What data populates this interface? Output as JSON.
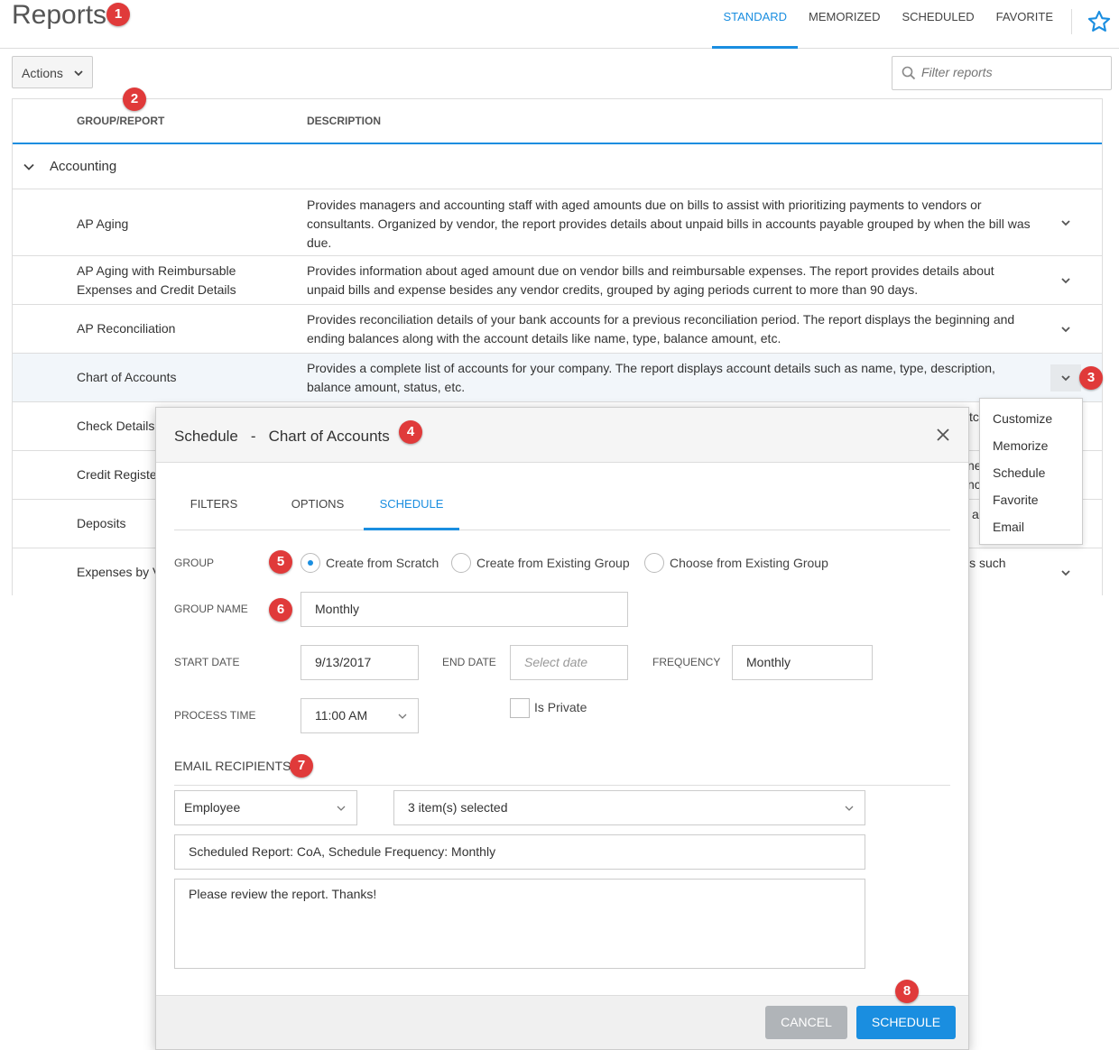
{
  "header": {
    "title": "Reports",
    "tabs": [
      {
        "label": "STANDARD",
        "active": true
      },
      {
        "label": "MEMORIZED"
      },
      {
        "label": "SCHEDULED"
      },
      {
        "label": "FAVORITE"
      }
    ],
    "star_icon": "star-outline-icon"
  },
  "toolbar": {
    "actions_label": "Actions",
    "filter_placeholder": "Filter reports"
  },
  "table": {
    "columns": [
      "GROUP/REPORT",
      "DESCRIPTION"
    ],
    "group": "Accounting",
    "rows": [
      {
        "name": "AP Aging",
        "desc": "Provides managers and accounting staff with aged amounts due on bills to assist with prioritizing payments to vendors or consultants. Organized by vendor, the report provides details about unpaid bills in accounts payable grouped by when the bill was due."
      },
      {
        "name": "AP Aging with Reimbursable Expenses and Credit Details",
        "desc": "Provides information about aged amount due on vendor bills and reimbursable expenses. The report provides details about unpaid bills and expense besides any vendor credits, grouped by aging periods current to more than 90 days."
      },
      {
        "name": "AP Reconciliation",
        "desc": "Provides reconciliation details of your bank accounts for a previous reconciliation period. The report displays the beginning and ending balances along with the account details like name, type, balance amount, etc."
      },
      {
        "name": "Chart of Accounts",
        "desc": "Provides a complete list of accounts for your company. The report displays account details such as name, type, description, balance amount, status, etc."
      },
      {
        "name": "Check Details",
        "desc": "tc"
      },
      {
        "name": "Credit Registe",
        "desc": "ne\nnc"
      },
      {
        "name": "Deposits",
        "desc": "a"
      },
      {
        "name": "Expenses by V",
        "desc": "ls such"
      }
    ]
  },
  "row_menu": [
    "Customize",
    "Memorize",
    "Schedule",
    "Favorite",
    "Email"
  ],
  "modal": {
    "title_left": "Schedule",
    "title_sep": "-",
    "title_right": "Chart of Accounts",
    "tabs": [
      "FILTERS",
      "OPTIONS",
      "SCHEDULE"
    ],
    "active_tab": "SCHEDULE",
    "group_label": "GROUP",
    "group_options": [
      "Create from Scratch",
      "Create from Existing Group",
      "Choose from Existing Group"
    ],
    "group_name_label": "GROUP NAME",
    "group_name_value": "Monthly",
    "start_date_label": "START DATE",
    "start_date_value": "9/13/2017",
    "end_date_label": "END DATE",
    "end_date_placeholder": "Select date",
    "frequency_label": "FREQUENCY",
    "frequency_value": "Monthly",
    "process_time_label": "PROCESS TIME",
    "process_time_value": "11:00 AM",
    "is_private_label": "Is Private",
    "email_recipients_label": "EMAIL RECIPIENTS",
    "recipient_type": "Employee",
    "recipients_selected": "3 item(s) selected",
    "subject": "Scheduled Report: CoA, Schedule Frequency: Monthly",
    "message": "Please review the report. Thanks!",
    "cancel_label": "CANCEL",
    "schedule_label": "SCHEDULE"
  },
  "badges": [
    "1",
    "2",
    "3",
    "4",
    "5",
    "6",
    "7",
    "8"
  ],
  "colors": {
    "accent": "#1a8ee0",
    "badge": "#e03a3a"
  }
}
